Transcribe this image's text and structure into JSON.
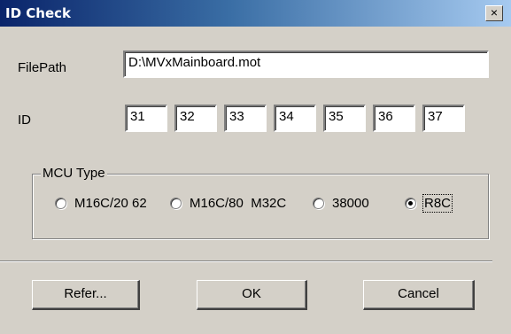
{
  "window": {
    "title": "ID Check",
    "close_glyph": "×"
  },
  "filepath": {
    "label": "FilePath",
    "value": "D:\\MVxMainboard.mot"
  },
  "id": {
    "label": "ID",
    "values": [
      "31",
      "32",
      "33",
      "34",
      "35",
      "36",
      "37"
    ]
  },
  "mcu": {
    "title": "MCU Type",
    "options": [
      {
        "label": "M16C/20 62",
        "checked": false
      },
      {
        "label": "M16C/80  M32C",
        "checked": false
      },
      {
        "label": "38000",
        "checked": false
      },
      {
        "label": "R8C",
        "checked": true
      }
    ]
  },
  "buttons": {
    "refer": "Refer...",
    "ok": "OK",
    "cancel": "Cancel"
  }
}
